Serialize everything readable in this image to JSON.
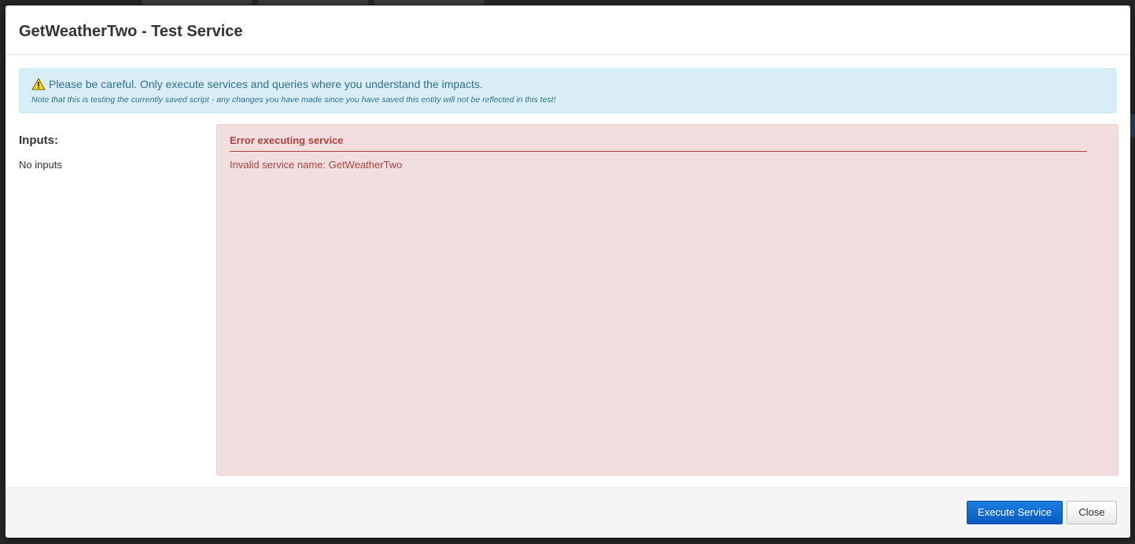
{
  "dialog": {
    "title": "GetWeatherTwo - Test Service"
  },
  "notice": {
    "icon": "warning-icon",
    "message": "Please be careful. Only execute services and queries where you understand the impacts.",
    "note": "Note that this is testing the currently saved script - any changes you have made since you have saved this entity will not be reflected in this test!"
  },
  "inputs": {
    "heading": "Inputs:",
    "empty_text": "No inputs"
  },
  "result": {
    "error_title": "Error executing service",
    "error_message": "Invalid service name: GetWeatherTwo"
  },
  "footer": {
    "execute_label": "Execute Service",
    "close_label": "Close"
  },
  "colors": {
    "info_bg": "#d9edf7",
    "info_text": "#31708f",
    "danger_bg": "#f2dede",
    "danger_text": "#a94442",
    "primary_button": "#0a5cc2"
  }
}
